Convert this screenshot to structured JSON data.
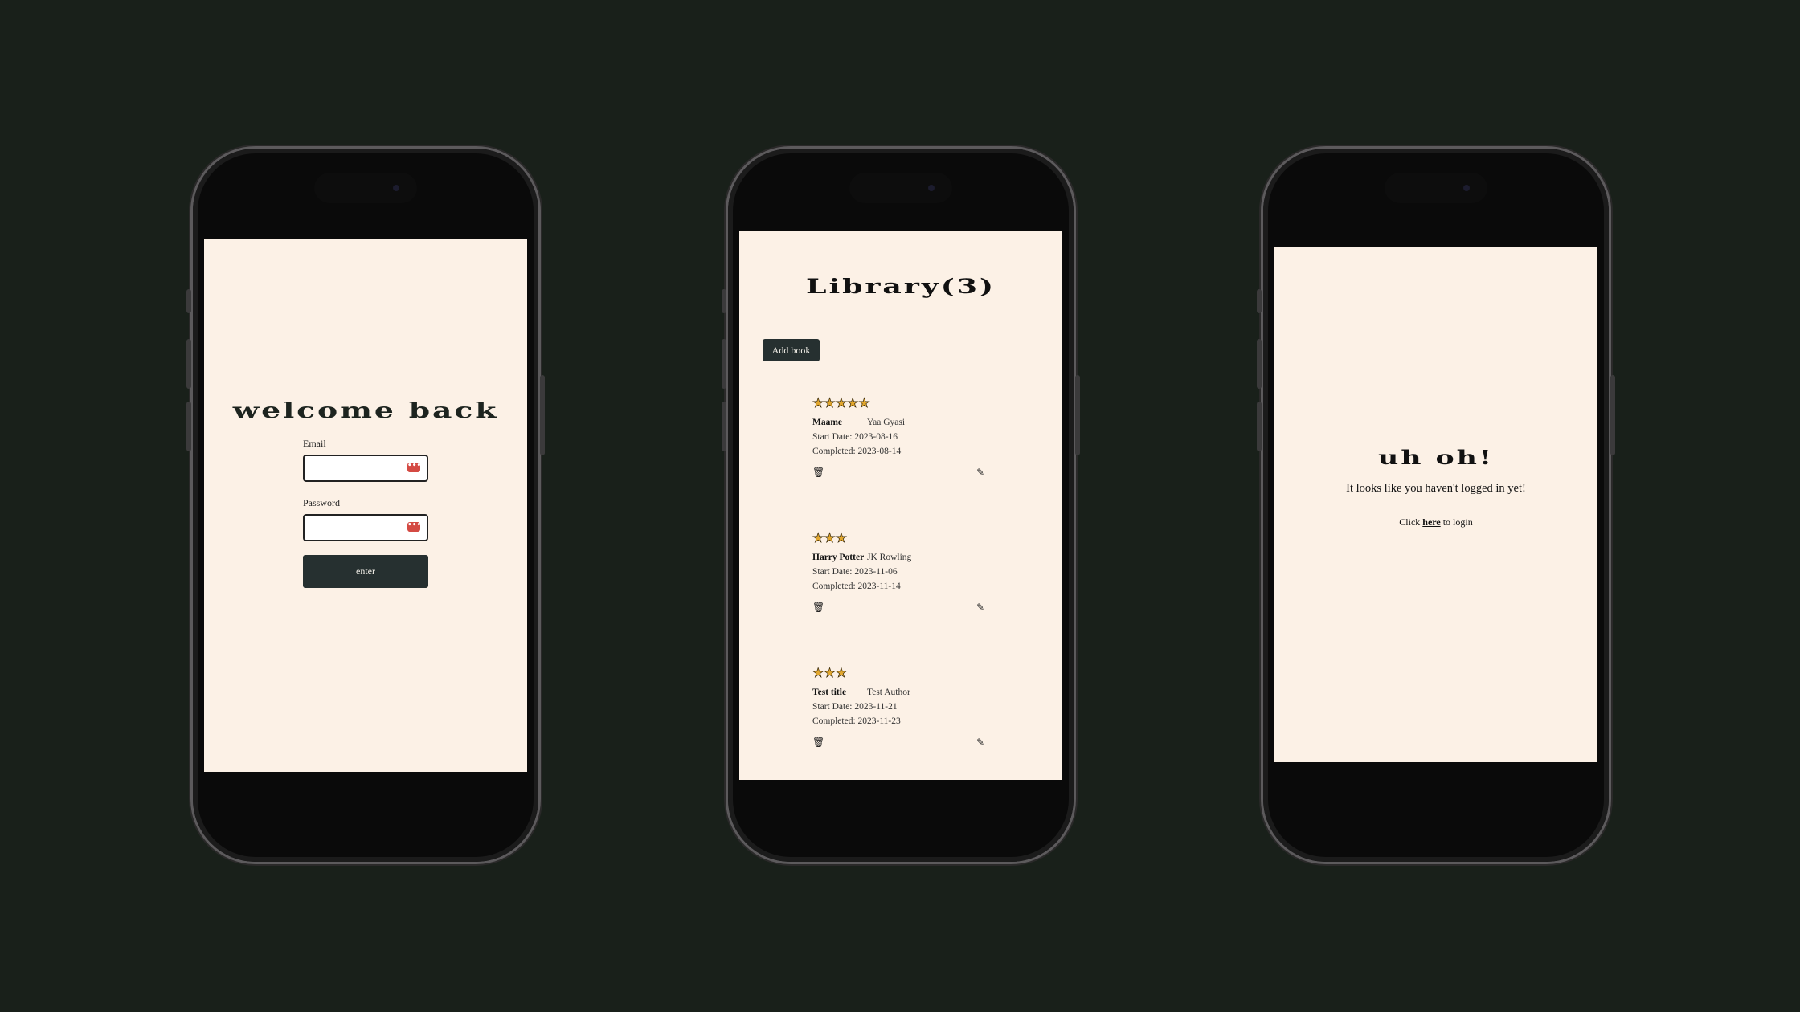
{
  "login": {
    "title": "welcome back",
    "email_label": "Email",
    "password_label": "Password",
    "submit_label": "enter",
    "email_value": "",
    "password_value": "",
    "autofill_icon": "key-icon"
  },
  "library": {
    "title": "Library(3)",
    "add_button_label": "Add book",
    "books": [
      {
        "stars": "★★★★★",
        "rating": 5,
        "title": "Maame",
        "author": "Yaa Gyasi",
        "start": "Start Date: 2023-08-16",
        "completed": "Completed: 2023-08-14"
      },
      {
        "stars": "★★★",
        "rating": 3,
        "title": "Harry Potter",
        "author": "JK Rowling",
        "start": "Start Date: 2023-11-06",
        "completed": "Completed: 2023-11-14"
      },
      {
        "stars": "★★★",
        "rating": 3,
        "title": "Test title",
        "author": "Test Author",
        "start": "Start Date: 2023-11-21",
        "completed": "Completed: 2023-11-23"
      }
    ],
    "delete_icon": "trash-icon",
    "edit_icon": "edit-icon"
  },
  "notlogged": {
    "title": "uh oh!",
    "message": "It looks like you haven't logged in yet!",
    "click_prefix": "Click ",
    "link_text": "here",
    "click_suffix": " to login"
  },
  "colors": {
    "background": "#19201a",
    "screen": "#fcf1e6",
    "button": "#263030",
    "star": "#e2a72e",
    "autofill_icon": "#d44a43"
  }
}
